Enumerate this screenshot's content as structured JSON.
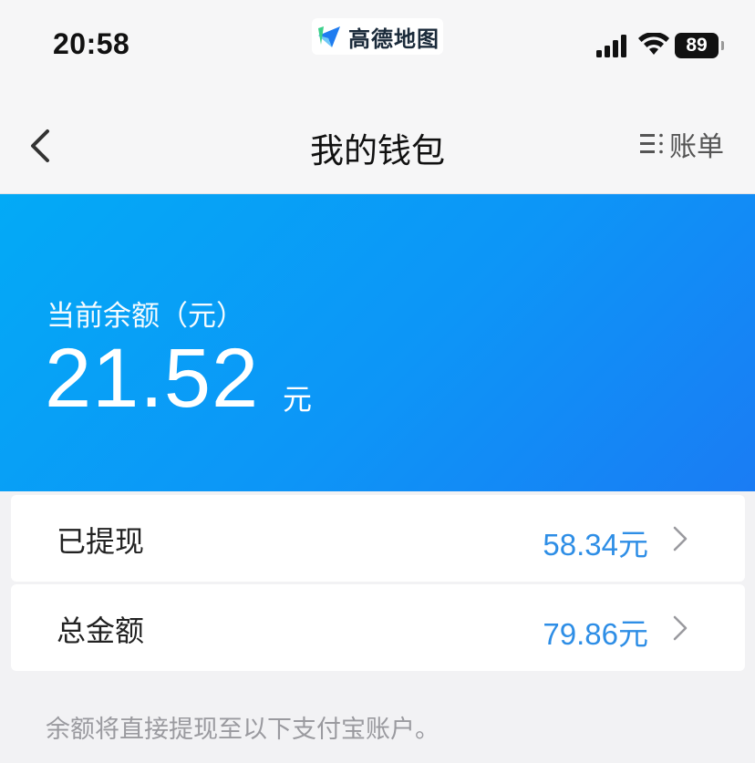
{
  "status_bar": {
    "time": "20:58",
    "app_badge": {
      "name": "高德地图",
      "icon": "amap-logo-icon"
    },
    "battery": "89",
    "icons": [
      "signal-icon",
      "wifi-icon",
      "battery-icon"
    ]
  },
  "nav": {
    "title": "我的钱包",
    "bill_label": "账单",
    "icons": [
      "back-arrow-icon",
      "list-icon"
    ]
  },
  "balance": {
    "label": "当前余额（元）",
    "amount": "21.52",
    "unit": "元"
  },
  "rows": [
    {
      "label": "已提现",
      "value": "58.34元"
    },
    {
      "label": "总金额",
      "value": "79.86元"
    }
  ],
  "note": "余额将直接提现至以下支付宝账户。",
  "colors": {
    "accent_blue": "#2e8ee6",
    "card_gradient_start": "#03aaf6",
    "card_gradient_end": "#1a7cf4",
    "page_bg": "#f2f2f4"
  }
}
